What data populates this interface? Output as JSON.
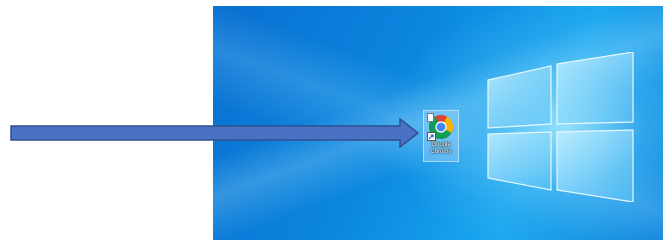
{
  "desktop": {
    "background_color": "#0b86df",
    "icons": [
      {
        "label": "Google\nChrome",
        "icon": "chrome-icon"
      }
    ]
  },
  "annotation": {
    "arrow_color": "#4a72c4",
    "arrow_outline": "#2f4f8f"
  }
}
